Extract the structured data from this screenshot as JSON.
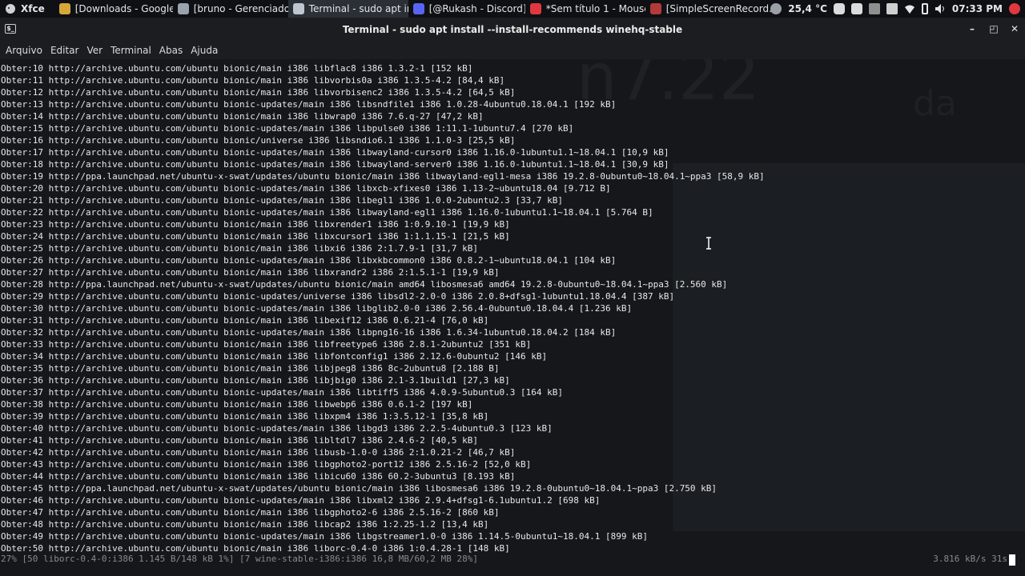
{
  "panel": {
    "app_menu": "Xfce",
    "tasks": [
      {
        "label": "[Downloads - Google ...",
        "color": "#d8a73a",
        "active": false
      },
      {
        "label": "[bruno - Gerenciador ...",
        "color": "#9aa3ad",
        "active": false
      },
      {
        "label": "Terminal - sudo apt in...",
        "color": "#bfc6cf",
        "active": true
      },
      {
        "label": "[@Rukash - Discord]",
        "color": "#5865f2",
        "active": false
      },
      {
        "label": "*Sem título 1 - Mouse...",
        "color": "#e0383e",
        "active": false
      },
      {
        "label": "[SimpleScreenRecord...",
        "color": "#b33a3a",
        "active": false
      }
    ],
    "temperature": "25,4 °C",
    "clock": "07:33 PM"
  },
  "window": {
    "title": "Terminal - sudo apt install --install-recommends winehq-stable"
  },
  "menu": [
    "Arquivo",
    "Editar",
    "Ver",
    "Terminal",
    "Abas",
    "Ajuda"
  ],
  "terminal": {
    "lines": [
      "Obter:10 http://archive.ubuntu.com/ubuntu bionic/main i386 libflac8 i386 1.3.2-1 [152 kB]",
      "Obter:11 http://archive.ubuntu.com/ubuntu bionic/main i386 libvorbis0a i386 1.3.5-4.2 [84,4 kB]",
      "Obter:12 http://archive.ubuntu.com/ubuntu bionic/main i386 libvorbisenc2 i386 1.3.5-4.2 [64,5 kB]",
      "Obter:13 http://archive.ubuntu.com/ubuntu bionic-updates/main i386 libsndfile1 i386 1.0.28-4ubuntu0.18.04.1 [192 kB]",
      "Obter:14 http://archive.ubuntu.com/ubuntu bionic/main i386 libwrap0 i386 7.6.q-27 [47,2 kB]",
      "Obter:15 http://archive.ubuntu.com/ubuntu bionic-updates/main i386 libpulse0 i386 1:11.1-1ubuntu7.4 [270 kB]",
      "Obter:16 http://archive.ubuntu.com/ubuntu bionic/universe i386 libsndio6.1 i386 1.1.0-3 [25,5 kB]",
      "Obter:17 http://archive.ubuntu.com/ubuntu bionic-updates/main i386 libwayland-cursor0 i386 1.16.0-1ubuntu1.1~18.04.1 [10,9 kB]",
      "Obter:18 http://archive.ubuntu.com/ubuntu bionic-updates/main i386 libwayland-server0 i386 1.16.0-1ubuntu1.1~18.04.1 [30,9 kB]",
      "Obter:19 http://ppa.launchpad.net/ubuntu-x-swat/updates/ubuntu bionic/main i386 libwayland-egl1-mesa i386 19.2.8-0ubuntu0~18.04.1~ppa3 [58,9 kB]",
      "Obter:20 http://archive.ubuntu.com/ubuntu bionic-updates/main i386 libxcb-xfixes0 i386 1.13-2~ubuntu18.04 [9.712 B]",
      "Obter:21 http://archive.ubuntu.com/ubuntu bionic-updates/main i386 libegl1 i386 1.0.0-2ubuntu2.3 [33,7 kB]",
      "Obter:22 http://archive.ubuntu.com/ubuntu bionic-updates/main i386 libwayland-egl1 i386 1.16.0-1ubuntu1.1~18.04.1 [5.764 B]",
      "Obter:23 http://archive.ubuntu.com/ubuntu bionic/main i386 libxrender1 i386 1:0.9.10-1 [19,9 kB]",
      "Obter:24 http://archive.ubuntu.com/ubuntu bionic/main i386 libxcursor1 i386 1:1.1.15-1 [21,5 kB]",
      "Obter:25 http://archive.ubuntu.com/ubuntu bionic/main i386 libxi6 i386 2:1.7.9-1 [31,7 kB]",
      "Obter:26 http://archive.ubuntu.com/ubuntu bionic-updates/main i386 libxkbcommon0 i386 0.8.2-1~ubuntu18.04.1 [104 kB]",
      "Obter:27 http://archive.ubuntu.com/ubuntu bionic/main i386 libxrandr2 i386 2:1.5.1-1 [19,9 kB]",
      "Obter:28 http://ppa.launchpad.net/ubuntu-x-swat/updates/ubuntu bionic/main amd64 libosmesa6 amd64 19.2.8-0ubuntu0~18.04.1~ppa3 [2.560 kB]",
      "Obter:29 http://archive.ubuntu.com/ubuntu bionic-updates/universe i386 libsdl2-2.0-0 i386 2.0.8+dfsg1-1ubuntu1.18.04.4 [387 kB]",
      "Obter:30 http://archive.ubuntu.com/ubuntu bionic-updates/main i386 libglib2.0-0 i386 2.56.4-0ubuntu0.18.04.4 [1.236 kB]",
      "Obter:31 http://archive.ubuntu.com/ubuntu bionic/main i386 libexif12 i386 0.6.21-4 [76,0 kB]",
      "Obter:32 http://archive.ubuntu.com/ubuntu bionic-updates/main i386 libpng16-16 i386 1.6.34-1ubuntu0.18.04.2 [184 kB]",
      "Obter:33 http://archive.ubuntu.com/ubuntu bionic/main i386 libfreetype6 i386 2.8.1-2ubuntu2 [351 kB]",
      "Obter:34 http://archive.ubuntu.com/ubuntu bionic/main i386 libfontconfig1 i386 2.12.6-0ubuntu2 [146 kB]",
      "Obter:35 http://archive.ubuntu.com/ubuntu bionic/main i386 libjpeg8 i386 8c-2ubuntu8 [2.188 B]",
      "Obter:36 http://archive.ubuntu.com/ubuntu bionic/main i386 libjbig0 i386 2.1-3.1build1 [27,3 kB]",
      "Obter:37 http://archive.ubuntu.com/ubuntu bionic-updates/main i386 libtiff5 i386 4.0.9-5ubuntu0.3 [164 kB]",
      "Obter:38 http://archive.ubuntu.com/ubuntu bionic/main i386 libwebp6 i386 0.6.1-2 [197 kB]",
      "Obter:39 http://archive.ubuntu.com/ubuntu bionic/main i386 libxpm4 i386 1:3.5.12-1 [35,8 kB]",
      "Obter:40 http://archive.ubuntu.com/ubuntu bionic-updates/main i386 libgd3 i386 2.2.5-4ubuntu0.3 [123 kB]",
      "Obter:41 http://archive.ubuntu.com/ubuntu bionic/main i386 libltdl7 i386 2.4.6-2 [40,5 kB]",
      "Obter:42 http://archive.ubuntu.com/ubuntu bionic/main i386 libusb-1.0-0 i386 2:1.0.21-2 [46,7 kB]",
      "Obter:43 http://archive.ubuntu.com/ubuntu bionic/main i386 libgphoto2-port12 i386 2.5.16-2 [52,0 kB]",
      "Obter:44 http://archive.ubuntu.com/ubuntu bionic/main i386 libicu60 i386 60.2-3ubuntu3 [8.193 kB]",
      "Obter:45 http://ppa.launchpad.net/ubuntu-x-swat/updates/ubuntu bionic/main i386 libosmesa6 i386 19.2.8-0ubuntu0~18.04.1~ppa3 [2.750 kB]",
      "Obter:46 http://archive.ubuntu.com/ubuntu bionic-updates/main i386 libxml2 i386 2.9.4+dfsg1-6.1ubuntu1.2 [698 kB]",
      "Obter:47 http://archive.ubuntu.com/ubuntu bionic/main i386 libgphoto2-6 i386 2.5.16-2 [860 kB]",
      "Obter:48 http://archive.ubuntu.com/ubuntu bionic/main i386 libcap2 i386 1:2.25-1.2 [13,4 kB]",
      "Obter:49 http://archive.ubuntu.com/ubuntu bionic-updates/main i386 libgstreamer1.0-0 i386 1.14.5-0ubuntu1~18.04.1 [899 kB]",
      "Obter:50 http://archive.ubuntu.com/ubuntu bionic/main i386 liborc-0.4-0 i386 1:0.4.28-1 [148 kB]"
    ],
    "status": "27% [50 liborc-0.4-0:i386 1.145 B/148 kB 1%] [7 wine-stable-i386:i386 16,8 MB/60,2 MB 28%]",
    "speed": "3.816 kB/s 31s"
  }
}
